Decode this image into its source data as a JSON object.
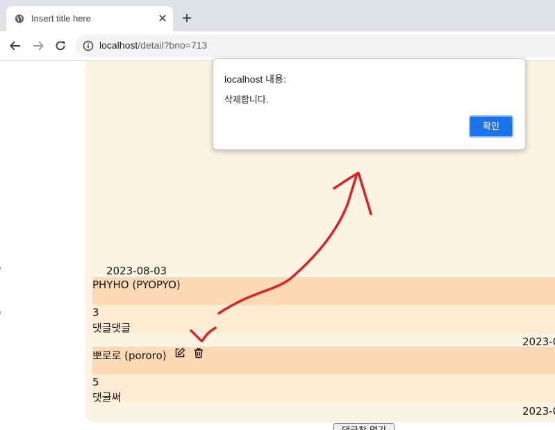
{
  "browser": {
    "tab_title": "Insert title here",
    "url_host": "localhost",
    "url_path": "/detail?bno=713"
  },
  "comments": [
    {
      "date": "2023-08-03",
      "author": "PHYHO (PYOPYO)",
      "number": "3",
      "text": "댓글댓글"
    },
    {
      "date": "2023-0",
      "author": "뽀로로 (pororo)",
      "number": "5",
      "text": "댓글써"
    }
  ],
  "trailing_date": "2023-0",
  "bottom_button_label": "댓글창 열기",
  "dialog": {
    "title": "localhost 내용:",
    "message": "삭제합니다.",
    "ok_label": "확인"
  },
  "icons": {
    "tab_favicon": "globe-icon",
    "tab_close": "close-icon",
    "new_tab": "plus-icon",
    "back": "arrow-left-icon",
    "forward": "arrow-right-icon",
    "reload": "reload-icon",
    "site_info": "info-icon",
    "edit": "edit-icon",
    "delete": "trash-icon"
  },
  "colors": {
    "panel_bg": "#fdf3e3",
    "comment_head_bg": "#fdd9b5",
    "comment_body_bg": "#fdecd4",
    "dialog_button": "#1a73e8",
    "annotation_arrow": "#e02020"
  }
}
